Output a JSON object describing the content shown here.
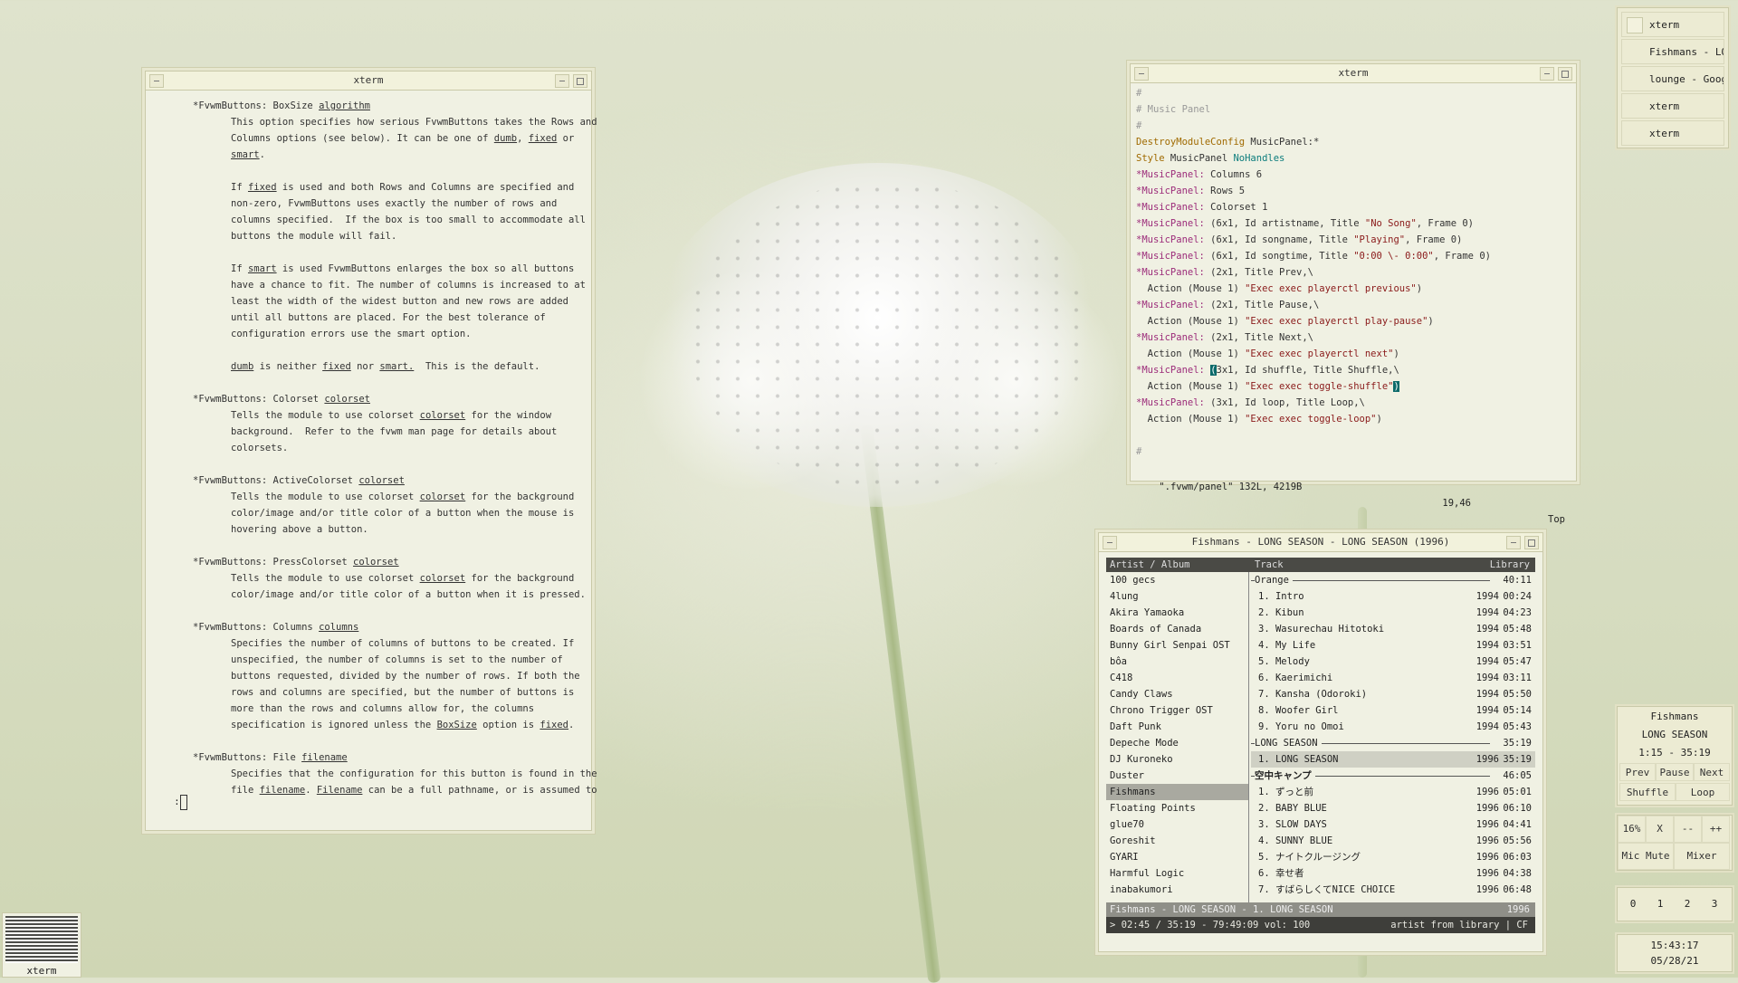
{
  "man_window": {
    "title": "xterm",
    "prompt": ":",
    "lines": [
      {
        "t": "sec",
        "parts": [
          [
            "*FvwmButtons: BoxSize ",
            0
          ],
          [
            "algorithm",
            1
          ]
        ]
      },
      {
        "t": "ind",
        "parts": [
          [
            "This option specifies how serious FvwmButtons takes the Rows and",
            0
          ]
        ]
      },
      {
        "t": "ind",
        "parts": [
          [
            "Columns options (see below). It can be one of ",
            0
          ],
          [
            "dumb",
            1
          ],
          [
            ", ",
            0
          ],
          [
            "fixed",
            1
          ],
          [
            " or",
            0
          ]
        ]
      },
      {
        "t": "ind",
        "parts": [
          [
            "smart",
            1
          ],
          [
            ".",
            0
          ]
        ]
      },
      {
        "t": "blank"
      },
      {
        "t": "ind",
        "parts": [
          [
            "If ",
            0
          ],
          [
            "fixed",
            1
          ],
          [
            " is used and both Rows and Columns are specified and",
            0
          ]
        ]
      },
      {
        "t": "ind",
        "parts": [
          [
            "non-zero, FvwmButtons uses exactly the number of rows and",
            0
          ]
        ]
      },
      {
        "t": "ind",
        "parts": [
          [
            "columns specified.  If the box is too small to accommodate all",
            0
          ]
        ]
      },
      {
        "t": "ind",
        "parts": [
          [
            "buttons the module will fail.",
            0
          ]
        ]
      },
      {
        "t": "blank"
      },
      {
        "t": "ind",
        "parts": [
          [
            "If ",
            0
          ],
          [
            "smart",
            1
          ],
          [
            " is used FvwmButtons enlarges the box so all buttons",
            0
          ]
        ]
      },
      {
        "t": "ind",
        "parts": [
          [
            "have a chance to fit. The number of columns is increased to at",
            0
          ]
        ]
      },
      {
        "t": "ind",
        "parts": [
          [
            "least the width of the widest button and new rows are added",
            0
          ]
        ]
      },
      {
        "t": "ind",
        "parts": [
          [
            "until all buttons are placed. For the best tolerance of",
            0
          ]
        ]
      },
      {
        "t": "ind",
        "parts": [
          [
            "configuration errors use the smart option.",
            0
          ]
        ]
      },
      {
        "t": "blank"
      },
      {
        "t": "ind",
        "parts": [
          [
            "dumb",
            1
          ],
          [
            " is neither ",
            0
          ],
          [
            "fixed",
            1
          ],
          [
            " nor ",
            0
          ],
          [
            "smart.",
            1
          ],
          [
            "  This is the default.",
            0
          ]
        ]
      },
      {
        "t": "blank"
      },
      {
        "t": "sec",
        "parts": [
          [
            "*FvwmButtons: Colorset ",
            0
          ],
          [
            "colorset",
            1
          ]
        ]
      },
      {
        "t": "ind",
        "parts": [
          [
            "Tells the module to use colorset ",
            0
          ],
          [
            "colorset",
            1
          ],
          [
            " for the window",
            0
          ]
        ]
      },
      {
        "t": "ind",
        "parts": [
          [
            "background.  Refer to the fvwm man page for details about",
            0
          ]
        ]
      },
      {
        "t": "ind",
        "parts": [
          [
            "colorsets.",
            0
          ]
        ]
      },
      {
        "t": "blank"
      },
      {
        "t": "sec",
        "parts": [
          [
            "*FvwmButtons: ActiveColorset ",
            0
          ],
          [
            "colorset",
            1
          ]
        ]
      },
      {
        "t": "ind",
        "parts": [
          [
            "Tells the module to use colorset ",
            0
          ],
          [
            "colorset",
            1
          ],
          [
            " for the background",
            0
          ]
        ]
      },
      {
        "t": "ind",
        "parts": [
          [
            "color/image and/or title color of a button when the mouse is",
            0
          ]
        ]
      },
      {
        "t": "ind",
        "parts": [
          [
            "hovering above a button.",
            0
          ]
        ]
      },
      {
        "t": "blank"
      },
      {
        "t": "sec",
        "parts": [
          [
            "*FvwmButtons: PressColorset ",
            0
          ],
          [
            "colorset",
            1
          ]
        ]
      },
      {
        "t": "ind",
        "parts": [
          [
            "Tells the module to use colorset ",
            0
          ],
          [
            "colorset",
            1
          ],
          [
            " for the background",
            0
          ]
        ]
      },
      {
        "t": "ind",
        "parts": [
          [
            "color/image and/or title color of a button when it is pressed.",
            0
          ]
        ]
      },
      {
        "t": "blank"
      },
      {
        "t": "sec",
        "parts": [
          [
            "*FvwmButtons: Columns ",
            0
          ],
          [
            "columns",
            1
          ]
        ]
      },
      {
        "t": "ind",
        "parts": [
          [
            "Specifies the number of columns of buttons to be created. If",
            0
          ]
        ]
      },
      {
        "t": "ind",
        "parts": [
          [
            "unspecified, the number of columns is set to the number of",
            0
          ]
        ]
      },
      {
        "t": "ind",
        "parts": [
          [
            "buttons requested, divided by the number of rows. If both the",
            0
          ]
        ]
      },
      {
        "t": "ind",
        "parts": [
          [
            "rows and columns are specified, but the number of buttons is",
            0
          ]
        ]
      },
      {
        "t": "ind",
        "parts": [
          [
            "more than the rows and columns allow for, the columns",
            0
          ]
        ]
      },
      {
        "t": "ind",
        "parts": [
          [
            "specification is ignored unless the ",
            0
          ],
          [
            "BoxSize",
            1
          ],
          [
            " option is ",
            0
          ],
          [
            "fixed",
            1
          ],
          [
            ".",
            0
          ]
        ]
      },
      {
        "t": "blank"
      },
      {
        "t": "sec",
        "parts": [
          [
            "*FvwmButtons: File ",
            0
          ],
          [
            "filename",
            1
          ]
        ]
      },
      {
        "t": "ind",
        "parts": [
          [
            "Specifies that the configuration for this button is found in the",
            0
          ]
        ]
      },
      {
        "t": "ind",
        "parts": [
          [
            "file ",
            0
          ],
          [
            "filename",
            1
          ],
          [
            ". ",
            0
          ],
          [
            "Filename",
            1
          ],
          [
            " can be a full pathname, or is assumed to",
            0
          ]
        ]
      }
    ]
  },
  "vim_window": {
    "title": "xterm",
    "lines": [
      [
        [
          "#",
          "c"
        ]
      ],
      [
        [
          "# Music Panel",
          "c"
        ]
      ],
      [
        [
          "#",
          "c"
        ]
      ],
      [
        [
          "DestroyModuleConfig",
          "kw"
        ],
        [
          " MusicPanel:*",
          ""
        ]
      ],
      [
        [
          "Style",
          "kw"
        ],
        [
          " MusicPanel ",
          ""
        ],
        [
          "NoHandles",
          "teal"
        ]
      ],
      [
        [
          "*MusicPanel:",
          "mag"
        ],
        [
          " Columns 6",
          ""
        ]
      ],
      [
        [
          "*MusicPanel:",
          "mag"
        ],
        [
          " Rows 5",
          ""
        ]
      ],
      [
        [
          "*MusicPanel:",
          "mag"
        ],
        [
          " Colorset 1",
          ""
        ]
      ],
      [
        [
          "*MusicPanel:",
          "mag"
        ],
        [
          " (6x1, Id artistname, Title ",
          ""
        ],
        [
          "\"No Song\"",
          "str"
        ],
        [
          ", Frame 0)",
          ""
        ]
      ],
      [
        [
          "*MusicPanel:",
          "mag"
        ],
        [
          " (6x1, Id songname, Title ",
          ""
        ],
        [
          "\"Playing\"",
          "str"
        ],
        [
          ", Frame 0)",
          ""
        ]
      ],
      [
        [
          "*MusicPanel:",
          "mag"
        ],
        [
          " (6x1, Id songtime, Title ",
          ""
        ],
        [
          "\"0:00 \\- 0:00\"",
          "str"
        ],
        [
          ", Frame 0)",
          ""
        ]
      ],
      [
        [
          "*MusicPanel:",
          "mag"
        ],
        [
          " (2x1, Title Prev,\\",
          ""
        ]
      ],
      [
        [
          "  Action (Mouse 1) ",
          ""
        ],
        [
          "\"Exec exec playerctl previous\"",
          "str"
        ],
        [
          ")",
          ""
        ]
      ],
      [
        [
          "*MusicPanel:",
          "mag"
        ],
        [
          " (2x1, Title Pause,\\",
          ""
        ]
      ],
      [
        [
          "  Action (Mouse 1) ",
          ""
        ],
        [
          "\"Exec exec playerctl play-pause\"",
          "str"
        ],
        [
          ")",
          ""
        ]
      ],
      [
        [
          "*MusicPanel:",
          "mag"
        ],
        [
          " (2x1, Title Next,\\",
          ""
        ]
      ],
      [
        [
          "  Action (Mouse 1) ",
          ""
        ],
        [
          "\"Exec exec playerctl next\"",
          "str"
        ],
        [
          ")",
          ""
        ]
      ],
      [
        [
          "*MusicPanel:",
          "mag"
        ],
        [
          " ",
          ""
        ],
        [
          "(",
          "cur"
        ],
        [
          "3x1, Id shuffle, Title Shuffle,\\",
          ""
        ]
      ],
      [
        [
          "  Action (Mouse 1) ",
          ""
        ],
        [
          "\"Exec exec toggle-shuffle\"",
          "str"
        ],
        [
          ")",
          "cur"
        ]
      ],
      [
        [
          "*MusicPanel:",
          "mag"
        ],
        [
          " (3x1, Id loop, Title Loop,\\",
          ""
        ]
      ],
      [
        [
          "  Action (Mouse 1) ",
          ""
        ],
        [
          "\"Exec exec toggle-loop\"",
          "str"
        ],
        [
          ")",
          ""
        ]
      ],
      [
        [
          "",
          ""
        ]
      ],
      [
        [
          "#",
          "c"
        ]
      ]
    ],
    "status_file": "\".fvwm/panel\" 132L, 4219B",
    "status_pos": "19,46",
    "status_top": "Top"
  },
  "music_window": {
    "title": "Fishmans - LONG SEASON - LONG SEASON (1996)",
    "head_left": "Artist / Album",
    "head_track": "Track",
    "head_right": "Library",
    "artists": [
      "100 gecs",
      "4lung",
      "Akira Yamaoka",
      "Boards of Canada",
      "Bunny Girl Senpai OST",
      "bôa",
      "C418",
      "Candy Claws",
      "Chrono Trigger OST",
      "Daft Punk",
      "Depeche Mode",
      "DJ Kuroneko",
      "Duster",
      "Fishmans",
      "Floating Points",
      "glue70",
      "Goreshit",
      "GYARI",
      "Harmful Logic",
      "inabakumori"
    ],
    "selected_artist": "Fishmans",
    "albums": [
      {
        "name": "Orange",
        "time": "40:11",
        "bold": false,
        "tracks": [
          [
            "1. Intro",
            "1994",
            "00:24"
          ],
          [
            "2. Kibun",
            "1994",
            "04:23"
          ],
          [
            "3. Wasurechau Hitotoki",
            "1994",
            "05:48"
          ],
          [
            "4. My Life",
            "1994",
            "03:51"
          ],
          [
            "5. Melody",
            "1994",
            "05:47"
          ],
          [
            "6. Kaerimichi",
            "1994",
            "03:11"
          ],
          [
            "7. Kansha (Odoroki)",
            "1994",
            "05:50"
          ],
          [
            "8. Woofer Girl",
            "1994",
            "05:14"
          ],
          [
            "9. Yoru no Omoi",
            "1994",
            "05:43"
          ]
        ]
      },
      {
        "name": "LONG SEASON",
        "time": "35:19",
        "bold": false,
        "tracks": [
          [
            "1. LONG SEASON",
            "1996",
            "35:19"
          ]
        ]
      },
      {
        "name": "空中キャンプ",
        "time": "46:05",
        "bold": true,
        "tracks": [
          [
            "1. ずっと前",
            "1996",
            "05:01"
          ],
          [
            "2. BABY BLUE",
            "1996",
            "06:10"
          ],
          [
            "3. SLOW DAYS",
            "1996",
            "04:41"
          ],
          [
            "4. SUNNY BLUE",
            "1996",
            "05:56"
          ],
          [
            "5. ナイトクルージング",
            "1996",
            "06:03"
          ],
          [
            "6. 幸せ者",
            "1996",
            "04:38"
          ],
          [
            "7. すばらしくてNICE CHOICE",
            "1996",
            "06:48"
          ]
        ]
      }
    ],
    "highlighted_track": "1. LONG SEASON",
    "status_left": "Fishmans - LONG SEASON -  1. LONG SEASON",
    "status_right": "1996",
    "cmd_left": "> 02:45 / 35:19 - 79:49:09 vol: 100",
    "cmd_right": "artist from library | CF"
  },
  "window_list": {
    "items": [
      "xterm",
      "Fishmans - LONG",
      "lounge - Google",
      "xterm",
      "xterm"
    ]
  },
  "music_panel": {
    "artist": "Fishmans",
    "song": "LONG SEASON",
    "time": "1:15 - 35:19",
    "prev": "Prev",
    "pause": "Pause",
    "next": "Next",
    "shuffle": "Shuffle",
    "loop": "Loop"
  },
  "volume_panel": {
    "level": "16%",
    "x": "X",
    "down": "--",
    "up": "++",
    "mic_mute": "Mic Mute",
    "mixer": "Mixer"
  },
  "pager": {
    "desks": [
      "0",
      "1",
      "2",
      "3"
    ]
  },
  "clock": {
    "time": "15:43:17",
    "date": "05/28/21"
  },
  "mini_icon": {
    "label": "xterm"
  }
}
